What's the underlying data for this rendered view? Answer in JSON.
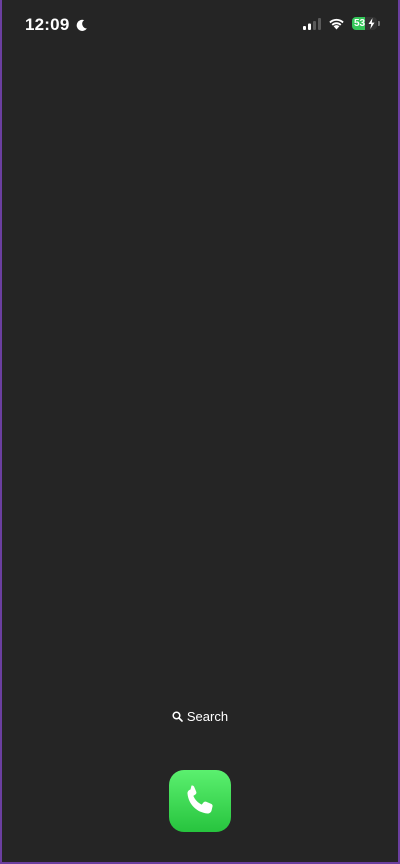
{
  "status_bar": {
    "time": "12:09",
    "focus_icon": "moon-icon",
    "signal_icon": "cellular-signal-icon",
    "wifi_icon": "wifi-icon",
    "battery_level": "53",
    "battery_charging_icon": "bolt-icon"
  },
  "home": {
    "search_label": "Search",
    "search_icon": "search-icon"
  },
  "dock": {
    "apps": [
      {
        "icon": "phone-icon"
      }
    ]
  },
  "colors": {
    "background": "#252525",
    "battery_green": "#34c759",
    "phone_green": "#34c759"
  }
}
